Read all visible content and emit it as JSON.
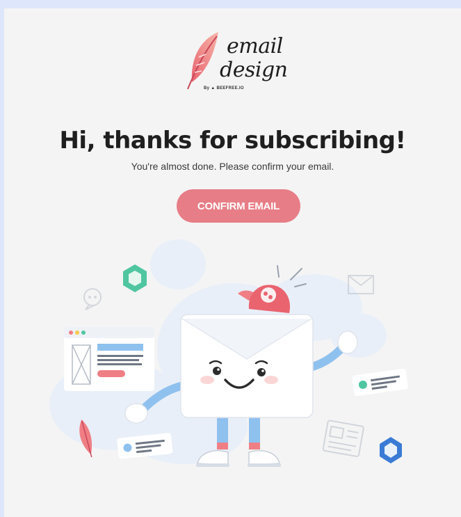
{
  "logo": {
    "line1": "email",
    "line2": "design",
    "byline": "By ▲ BEEFREE.IO"
  },
  "headline": "Hi, thanks for subscribing!",
  "subtitle": "You're almost done. Please confirm your email.",
  "cta": {
    "label": "CONFIRM EMAIL"
  },
  "colors": {
    "page_background": "#dde6fb",
    "card_background": "#f4f4f4",
    "accent": "#e77d86",
    "feather": "#ef7f85",
    "limbs": "#8fc1ee",
    "hexagon_green": "#4fc6a0",
    "hexagon_blue": "#3a7bd5"
  },
  "illustration": {
    "character": "envelope-mascot",
    "icons": [
      "hexagon-icon",
      "chat-bubble-icon",
      "cap-icon",
      "envelope-icon",
      "newsletter-icon",
      "feather-icon",
      "browser-window-icon"
    ]
  }
}
